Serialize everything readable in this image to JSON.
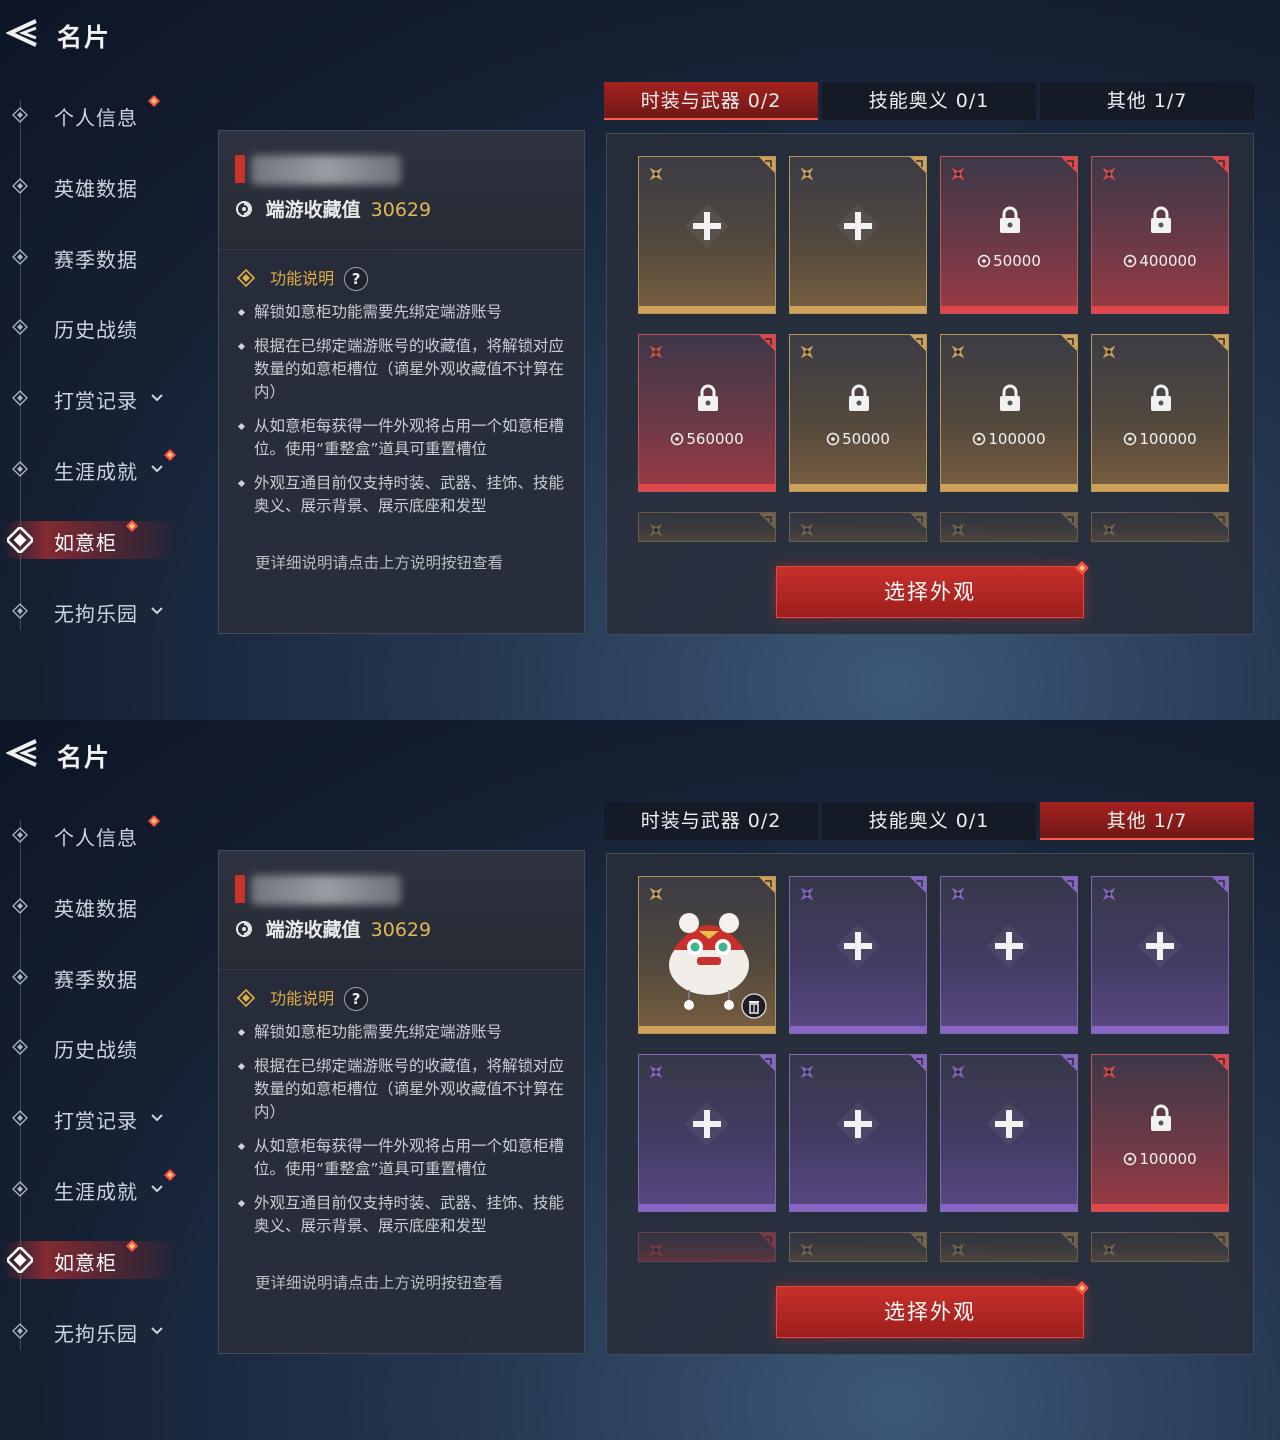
{
  "screens": [
    {
      "title": "名片",
      "nav": [
        {
          "label": "个人信息",
          "dot": true,
          "chevron": false,
          "active": false
        },
        {
          "label": "英雄数据",
          "dot": false,
          "chevron": false,
          "active": false
        },
        {
          "label": "赛季数据",
          "dot": false,
          "chevron": false,
          "active": false
        },
        {
          "label": "历史战绩",
          "dot": false,
          "chevron": false,
          "active": false
        },
        {
          "label": "打赏记录",
          "dot": false,
          "chevron": true,
          "active": false
        },
        {
          "label": "生涯成就",
          "dot": true,
          "chevron": true,
          "active": false
        },
        {
          "label": "如意柜",
          "dot": true,
          "chevron": false,
          "active": true
        },
        {
          "label": "无拘乐园",
          "dot": false,
          "chevron": true,
          "active": false
        }
      ],
      "info": {
        "collection_label": "端游收藏值",
        "collection_value": "30629",
        "func_label": "功能说明",
        "help": "?",
        "bullets": [
          "解锁如意柜功能需要先绑定端游账号",
          "根据在已绑定端游账号的收藏值，将解锁对应数量的如意柜槽位（谪星外观收藏值不计算在内）",
          "从如意柜每获得一件外观将占用一个如意柜槽位。使用“重整盒”道具可重置槽位",
          "外观互通目前仅支持时装、武器、挂饰、技能奥义、展示背景、展示底座和发型"
        ],
        "more": "更详细说明请点击上方说明按钮查看"
      },
      "tabs": [
        {
          "label": "时装与武器 0/2",
          "active": true
        },
        {
          "label": "技能奥义 0/1",
          "active": false
        },
        {
          "label": "其他 1/7",
          "active": false
        }
      ],
      "slots": [
        {
          "tier": "gold",
          "state": "empty"
        },
        {
          "tier": "gold",
          "state": "empty"
        },
        {
          "tier": "red",
          "state": "locked",
          "cost": "50000"
        },
        {
          "tier": "red",
          "state": "locked",
          "cost": "400000"
        },
        {
          "tier": "red",
          "state": "locked",
          "cost": "560000"
        },
        {
          "tier": "gold",
          "state": "locked",
          "cost": "50000"
        },
        {
          "tier": "gold",
          "state": "locked",
          "cost": "100000"
        },
        {
          "tier": "gold",
          "state": "locked",
          "cost": "100000"
        }
      ],
      "partial_tiers": [
        "gold",
        "gold",
        "gold",
        "gold"
      ],
      "select_button": "选择外观"
    },
    {
      "title": "名片",
      "nav": [
        {
          "label": "个人信息",
          "dot": true,
          "chevron": false,
          "active": false
        },
        {
          "label": "英雄数据",
          "dot": false,
          "chevron": false,
          "active": false
        },
        {
          "label": "赛季数据",
          "dot": false,
          "chevron": false,
          "active": false
        },
        {
          "label": "历史战绩",
          "dot": false,
          "chevron": false,
          "active": false
        },
        {
          "label": "打赏记录",
          "dot": false,
          "chevron": true,
          "active": false
        },
        {
          "label": "生涯成就",
          "dot": true,
          "chevron": true,
          "active": false
        },
        {
          "label": "如意柜",
          "dot": true,
          "chevron": false,
          "active": true
        },
        {
          "label": "无拘乐园",
          "dot": false,
          "chevron": true,
          "active": false
        }
      ],
      "info": {
        "collection_label": "端游收藏值",
        "collection_value": "30629",
        "func_label": "功能说明",
        "help": "?",
        "bullets": [
          "解锁如意柜功能需要先绑定端游账号",
          "根据在已绑定端游账号的收藏值，将解锁对应数量的如意柜槽位（谪星外观收藏值不计算在内）",
          "从如意柜每获得一件外观将占用一个如意柜槽位。使用“重整盒”道具可重置槽位",
          "外观互通目前仅支持时装、武器、挂饰、技能奥义、展示背景、展示底座和发型"
        ],
        "more": "更详细说明请点击上方说明按钮查看"
      },
      "tabs": [
        {
          "label": "时装与武器 0/2",
          "active": false
        },
        {
          "label": "技能奥义 0/1",
          "active": false
        },
        {
          "label": "其他 1/7",
          "active": true
        }
      ],
      "slots": [
        {
          "tier": "gold",
          "state": "item"
        },
        {
          "tier": "purple",
          "state": "empty"
        },
        {
          "tier": "purple",
          "state": "empty"
        },
        {
          "tier": "purple",
          "state": "empty"
        },
        {
          "tier": "purple",
          "state": "empty"
        },
        {
          "tier": "purple",
          "state": "empty"
        },
        {
          "tier": "purple",
          "state": "empty"
        },
        {
          "tier": "red",
          "state": "locked",
          "cost": "100000"
        }
      ],
      "partial_tiers": [
        "red",
        "gold",
        "gold",
        "gold"
      ],
      "select_button": "选择外观"
    }
  ],
  "colors": {
    "gold": "#cda25c",
    "red": "#e0474d",
    "purple": "#8866c4",
    "accent": "#c8302b",
    "value": "#e3b75a"
  }
}
